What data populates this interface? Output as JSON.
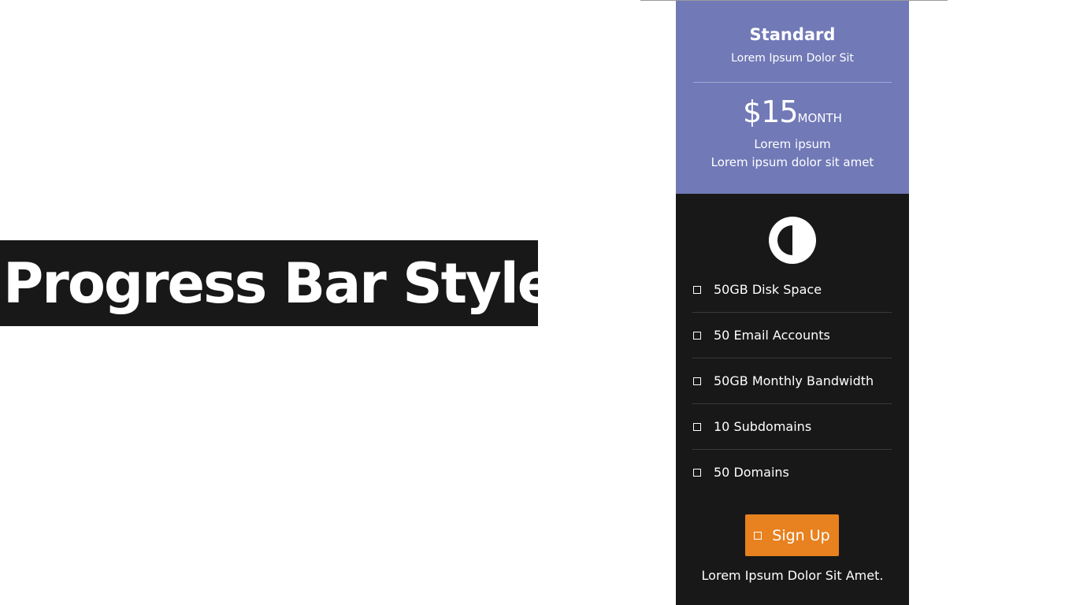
{
  "banner": {
    "title": "Progress Bar Styles"
  },
  "pricing_card": {
    "plan_name": "Standard",
    "plan_subtitle": "Lorem Ipsum Dolor Sit",
    "price": "$15",
    "period": "MONTH",
    "price_note_1": "Lorem ipsum",
    "price_note_2": "Lorem ipsum dolor sit amet",
    "plan_icon": "half-circle-icon",
    "features": [
      {
        "label": "50GB Disk Space",
        "icon": "checkbox-icon"
      },
      {
        "label": "50 Email Accounts",
        "icon": "checkbox-icon"
      },
      {
        "label": "50GB Monthly Bandwidth",
        "icon": "checkbox-icon"
      },
      {
        "label": "10 Subdomains",
        "icon": "checkbox-icon"
      },
      {
        "label": "50 Domains",
        "icon": "checkbox-icon"
      }
    ],
    "signup_button": {
      "label": "Sign Up",
      "icon": "checkbox-icon"
    },
    "footer_text": "Lorem Ipsum Dolor Sit Amet."
  },
  "colors": {
    "banner_bg": "#181818",
    "header_bg": "#7179b7",
    "body_bg": "#181818",
    "button_bg": "#e8811f",
    "text": "#ffffff"
  }
}
